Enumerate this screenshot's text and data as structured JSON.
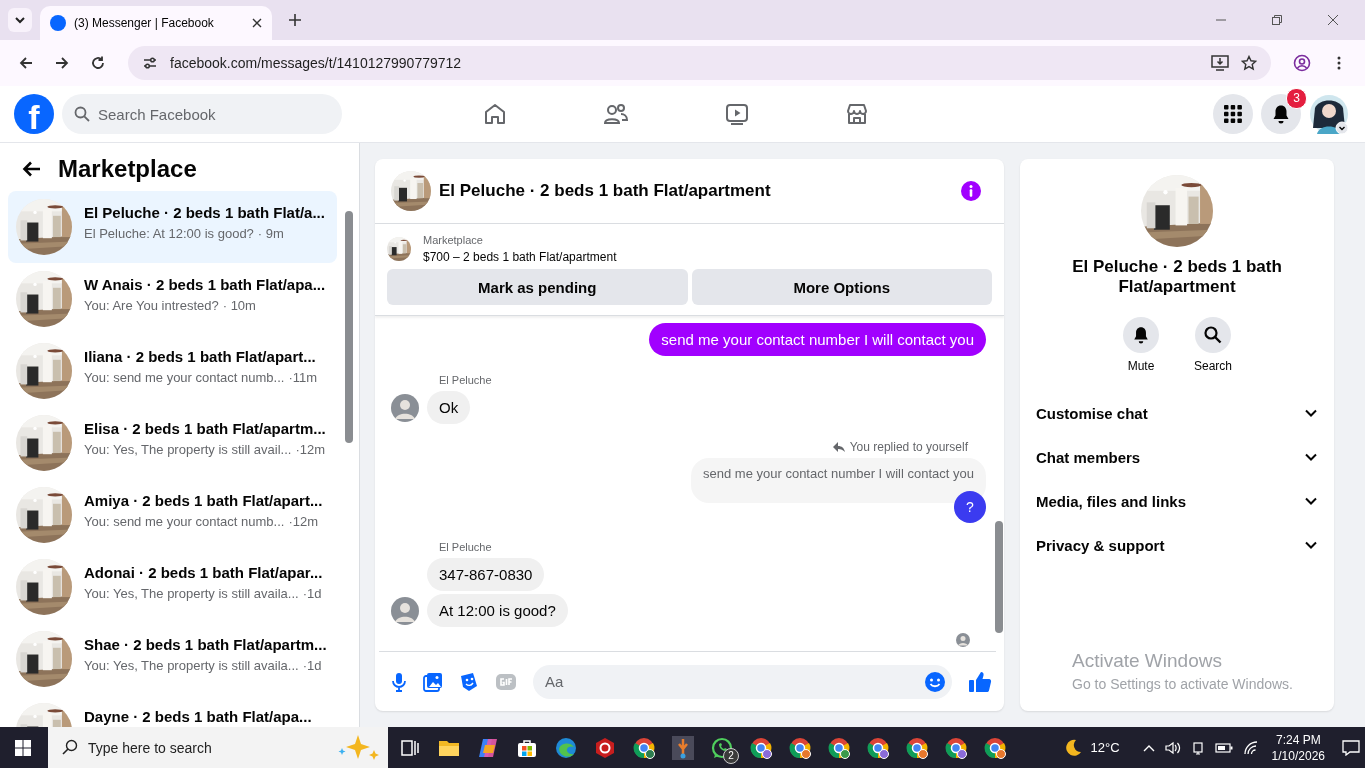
{
  "browser": {
    "tab_title": "(3) Messenger | Facebook",
    "url": "facebook.com/messages/t/1410127990779712"
  },
  "header": {
    "logo": "f",
    "search_placeholder": "Search Facebook",
    "notification_count": "3"
  },
  "sidebar": {
    "title": "Marketplace",
    "conversations": [
      {
        "title": "El Peluche · 2 beds 1 bath Flat/a...",
        "preview": "El Peluche: At 12:00 is good?",
        "time": "· 9m",
        "selected": true
      },
      {
        "title": "W Anais · 2 beds 1 bath Flat/apa...",
        "preview": "You: Are You intrested?",
        "time": "· 10m",
        "selected": false
      },
      {
        "title": "Iliana · 2 beds 1 bath Flat/apart...",
        "preview": "You: send me your contact numb...",
        "time": "·11m",
        "selected": false
      },
      {
        "title": "Elisa · 2 beds 1 bath Flat/apartm...",
        "preview": "You: Yes, The property is still avail...",
        "time": "·12m",
        "selected": false
      },
      {
        "title": "Amiya · 2 beds 1 bath Flat/apart...",
        "preview": "You: send me your contact numb...",
        "time": "·12m",
        "selected": false
      },
      {
        "title": "Adonai · 2 beds 1 bath Flat/apar...",
        "preview": "You: Yes, The property is still availa...",
        "time": "·1d",
        "selected": false
      },
      {
        "title": "Shae · 2 beds 1 bath Flat/apartm...",
        "preview": "You: Yes, The property is still availa...",
        "time": "·1d",
        "selected": false
      },
      {
        "title": "Dayne · 2 beds 1 bath Flat/apa...",
        "selected": false
      }
    ]
  },
  "chat": {
    "title": "El Peluche · 2 beds 1 bath Flat/apartment",
    "listing": {
      "label": "Marketplace",
      "detail": "$700 – 2 beds 1 bath Flat/apartment",
      "buttons": [
        "Mark as pending",
        "More Options"
      ]
    },
    "messages": [
      {
        "kind": "outgoing",
        "texts": [
          "send me your contact number I will contact you"
        ]
      },
      {
        "kind": "incoming",
        "sender": "El Peluche",
        "texts": [
          "Ok"
        ]
      },
      {
        "kind": "reply",
        "note": "You replied to yourself",
        "quoted": "send me your contact number I will contact you",
        "texts": [
          "?"
        ]
      },
      {
        "kind": "incoming",
        "sender": "El Peluche",
        "texts": [
          "347-867-0830",
          "At 12:00 is good?"
        ]
      }
    ],
    "composer_placeholder": "Aa"
  },
  "details": {
    "title": "El Peluche · 2 beds 1 bath Flat/apartment",
    "actions": [
      {
        "kind": "mute",
        "label": "Mute"
      },
      {
        "kind": "search",
        "label": "Search"
      }
    ],
    "sections": [
      {
        "label": "Customise chat",
        "expanded": false
      },
      {
        "label": "Chat members",
        "expanded": false
      },
      {
        "label": "Media, files and links",
        "expanded": false
      },
      {
        "label": "Privacy & support",
        "expanded": false
      }
    ]
  },
  "activation_notice": {
    "title": "Activate Windows",
    "subtitle": "Go to Settings to activate Windows."
  },
  "taskbar": {
    "search_placeholder": "Type here to search",
    "whatsapp_badge": "2",
    "temperature": "12°C",
    "time": "7:24 PM",
    "date": "1/10/2026"
  }
}
